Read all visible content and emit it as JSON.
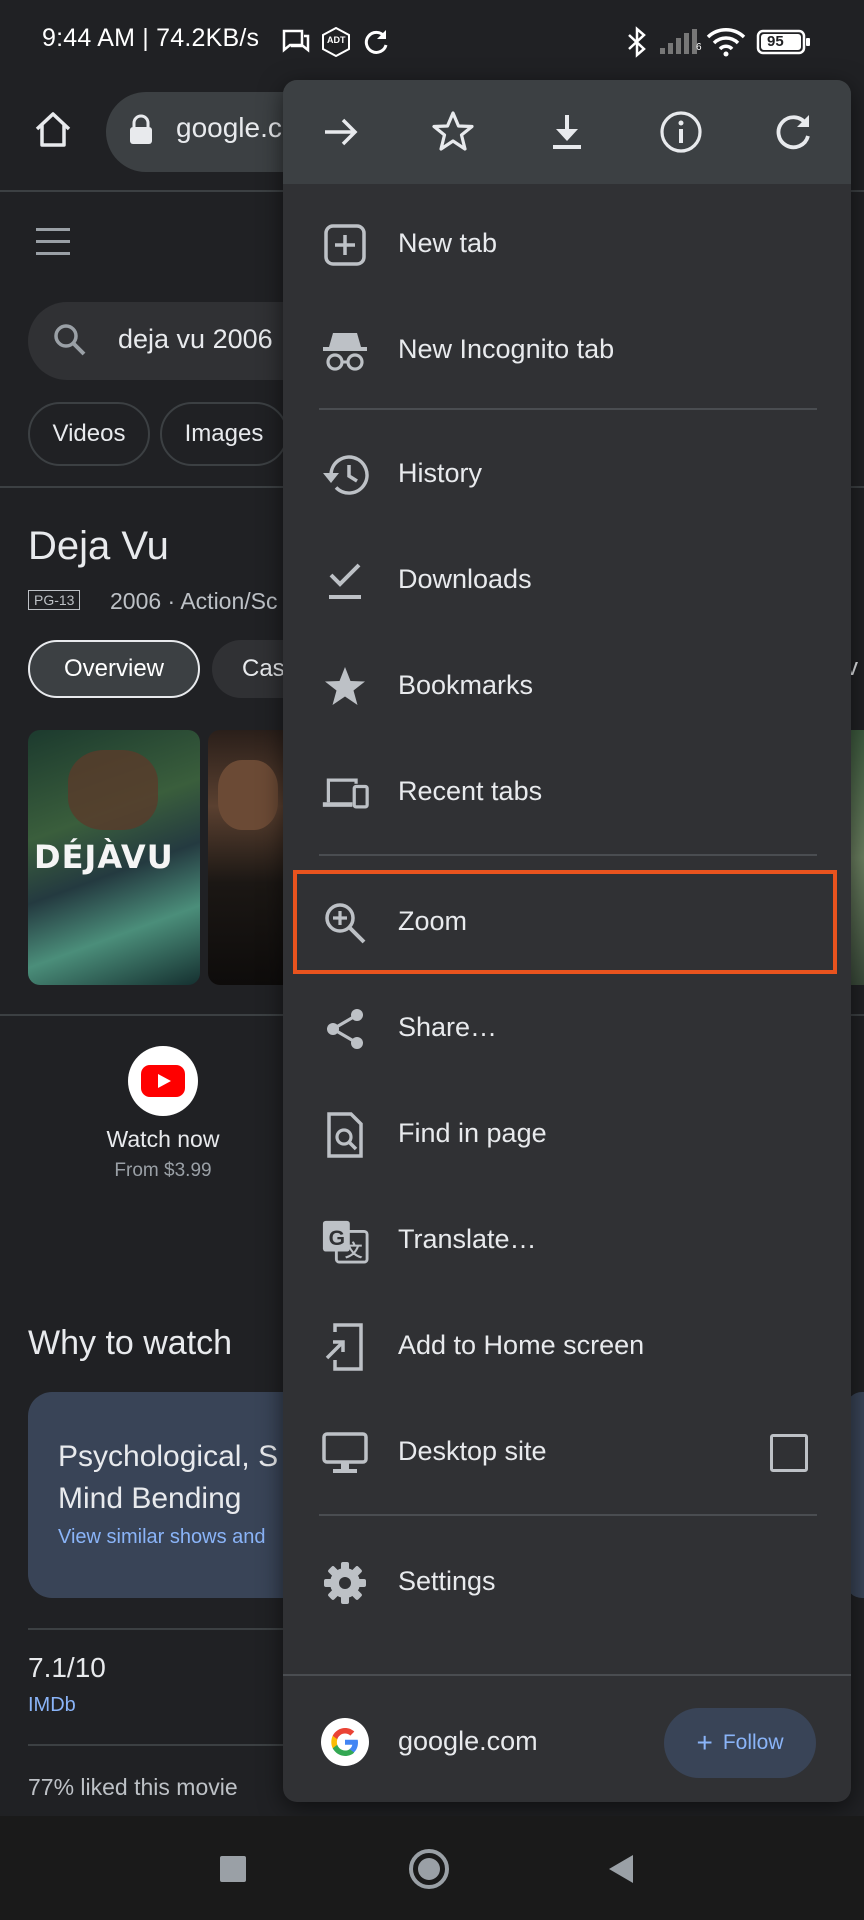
{
  "status_bar": {
    "text": "9:44 AM | 74.2KB/s",
    "carrier_badge": "ADT",
    "signal_label": "6",
    "battery": "95"
  },
  "toolbar": {
    "url": "google.c"
  },
  "search": {
    "query": "deja vu 2006"
  },
  "filter_chips": [
    "Videos",
    "Images"
  ],
  "movie": {
    "title": "Deja Vu",
    "rating": "PG-13",
    "meta": "2006 · Action/Sc",
    "tabs": {
      "overview": "Overview",
      "cast": "Cas",
      "edge": "v"
    },
    "poster_1_title": "DÉJÀVU",
    "watch": {
      "label": "Watch now",
      "price": "From $3.99"
    },
    "why_heading": "Why to watch",
    "why_card": {
      "title": "Psychological, S\nMind Bending",
      "link": "View similar shows and"
    },
    "imdb": {
      "score": "7.1/10",
      "source": "IMDb"
    },
    "liked": "77% liked this movie"
  },
  "menu": {
    "action_icons": [
      "forward-icon",
      "bookmark-star-icon",
      "download-icon",
      "page-info-icon",
      "refresh-icon"
    ],
    "items": [
      {
        "label": "New tab",
        "icon": "new-tab-icon"
      },
      {
        "label": "New Incognito tab",
        "icon": "incognito-icon"
      },
      {
        "label": "History",
        "icon": "history-icon"
      },
      {
        "label": "Downloads",
        "icon": "downloads-icon"
      },
      {
        "label": "Bookmarks",
        "icon": "bookmarks-star-icon"
      },
      {
        "label": "Recent tabs",
        "icon": "devices-icon"
      },
      {
        "label": "Zoom",
        "icon": "zoom-in-icon"
      },
      {
        "label": "Share…",
        "icon": "share-icon"
      },
      {
        "label": "Find in page",
        "icon": "find-in-page-icon"
      },
      {
        "label": "Translate…",
        "icon": "translate-icon"
      },
      {
        "label": "Add to Home screen",
        "icon": "add-to-home-icon"
      },
      {
        "label": "Desktop site",
        "icon": "desktop-icon"
      },
      {
        "label": "Settings",
        "icon": "settings-gear-icon"
      }
    ],
    "desktop_site_checked": false,
    "footer": {
      "site": "google.com",
      "follow_label": "Follow"
    }
  },
  "colors": {
    "background": "#202124",
    "menu_bg": "#303134",
    "menu_action_row": "#3c4043",
    "highlight_outline": "#e8531e",
    "link_blue": "#8ab4f8"
  }
}
